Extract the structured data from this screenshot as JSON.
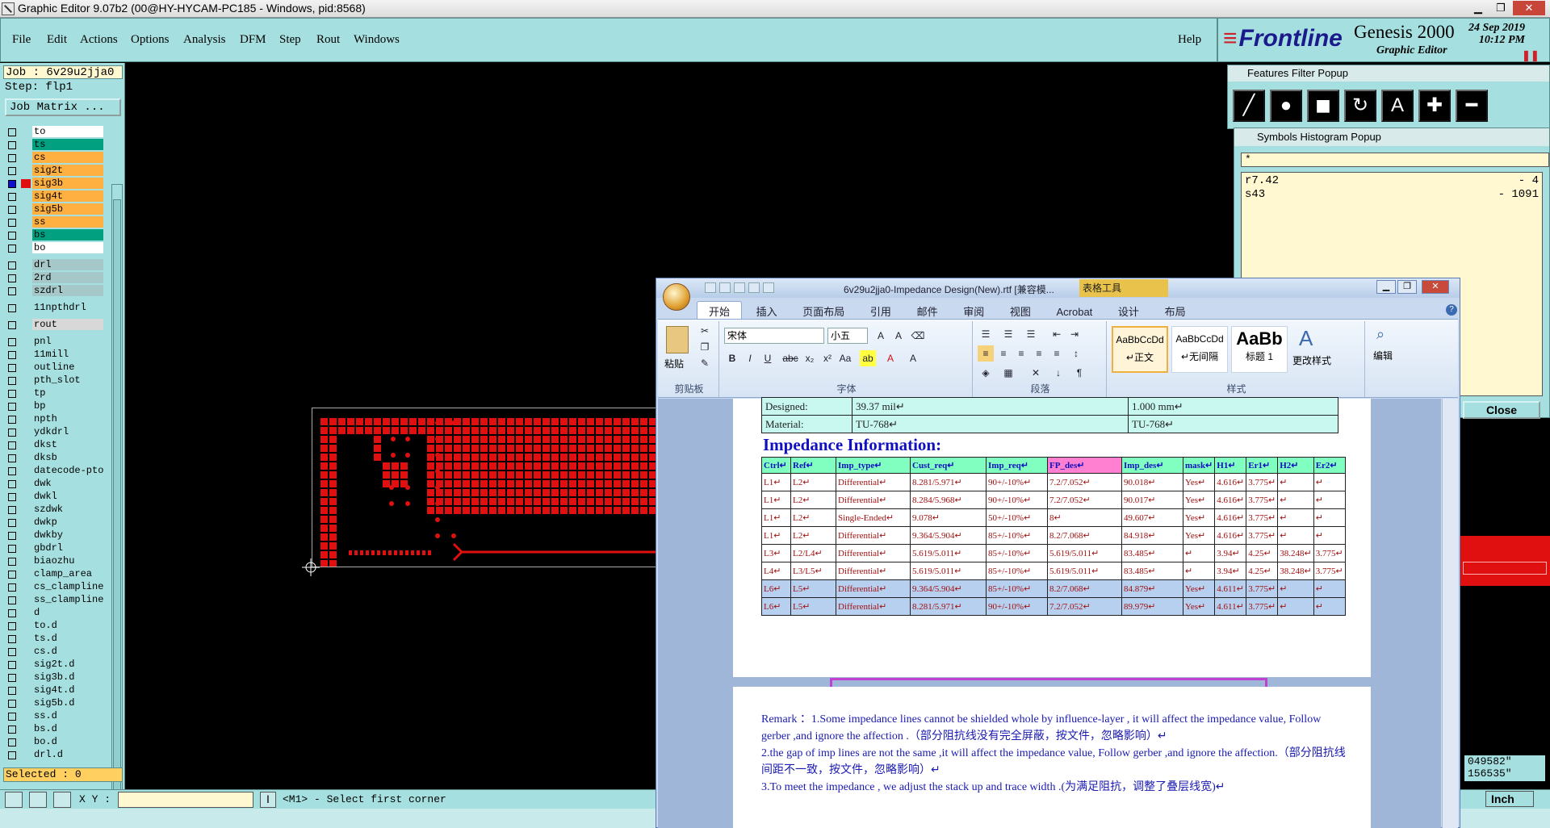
{
  "titlebar": {
    "title": "Graphic Editor 9.07b2 (00@HY-HYCAM-PC185 - Windows, pid:8568)"
  },
  "menu": {
    "items": [
      "File",
      "Edit",
      "Actions",
      "Options",
      "Analysis",
      "DFM",
      "Step",
      "Rout",
      "Windows"
    ],
    "help": "Help"
  },
  "logo": {
    "brand": "Frontline",
    "product": "Genesis 2000",
    "subtitle": "Graphic Editor",
    "date": "24 Sep 2019",
    "time": "10:12 PM"
  },
  "job": {
    "job_label": "Job : 6v29u2jja0",
    "step_label": "Step: flp1",
    "matrix_button": "Job Matrix ..."
  },
  "layers": [
    {
      "name": "to",
      "color": "#ffffff",
      "g": 0
    },
    {
      "name": "ts",
      "color": "#00a080",
      "g": 0
    },
    {
      "name": "cs",
      "color": "#ffb040",
      "g": 0
    },
    {
      "name": "sig2t",
      "color": "#ffb040",
      "g": 0
    },
    {
      "name": "sig3b",
      "color": "#ffb040",
      "g": 0,
      "active": true
    },
    {
      "name": "sig4t",
      "color": "#ffb040",
      "g": 0
    },
    {
      "name": "sig5b",
      "color": "#ffb040",
      "g": 0
    },
    {
      "name": "ss",
      "color": "#ffb040",
      "g": 0
    },
    {
      "name": "bs",
      "color": "#00a080",
      "g": 0
    },
    {
      "name": "bo",
      "color": "#ffffff",
      "g": 0
    },
    {
      "name": "drl",
      "color": "#a6c8c8",
      "g": 1
    },
    {
      "name": "2rd",
      "color": "#a6c8c8",
      "g": 1
    },
    {
      "name": "szdrl",
      "color": "#a6c8c8",
      "g": 1
    },
    {
      "name": "11npthdrl",
      "color": "#a6dfe0",
      "g": 2
    },
    {
      "name": "rout",
      "color": "#d8d8d8",
      "g": 3
    },
    {
      "name": "pnl",
      "color": "#a6dfe0",
      "g": 4
    },
    {
      "name": "11mill",
      "color": "#a6dfe0",
      "g": 4
    },
    {
      "name": "outline",
      "color": "#a6dfe0",
      "g": 4
    },
    {
      "name": "pth_slot",
      "color": "#a6dfe0",
      "g": 4
    },
    {
      "name": "tp",
      "color": "#a6dfe0",
      "g": 4
    },
    {
      "name": "bp",
      "color": "#a6dfe0",
      "g": 4
    },
    {
      "name": "npth",
      "color": "#a6dfe0",
      "g": 4
    },
    {
      "name": "ydkdrl",
      "color": "#a6dfe0",
      "g": 4
    },
    {
      "name": "dkst",
      "color": "#a6dfe0",
      "g": 4
    },
    {
      "name": "dksb",
      "color": "#a6dfe0",
      "g": 4
    },
    {
      "name": "datecode-pto",
      "color": "#a6dfe0",
      "g": 4
    },
    {
      "name": "dwk",
      "color": "#a6dfe0",
      "g": 4
    },
    {
      "name": "dwkl",
      "color": "#a6dfe0",
      "g": 4
    },
    {
      "name": "szdwk",
      "color": "#a6dfe0",
      "g": 4
    },
    {
      "name": "dwkp",
      "color": "#a6dfe0",
      "g": 4
    },
    {
      "name": "dwkby",
      "color": "#a6dfe0",
      "g": 4
    },
    {
      "name": "gbdrl",
      "color": "#a6dfe0",
      "g": 4
    },
    {
      "name": "biaozhu",
      "color": "#a6dfe0",
      "g": 4
    },
    {
      "name": "clamp_area",
      "color": "#a6dfe0",
      "g": 4
    },
    {
      "name": "cs_clampline",
      "color": "#a6dfe0",
      "g": 4
    },
    {
      "name": "ss_clampline",
      "color": "#a6dfe0",
      "g": 4
    },
    {
      "name": "d",
      "color": "#a6dfe0",
      "g": 4
    },
    {
      "name": "to.d",
      "color": "#a6dfe0",
      "g": 4
    },
    {
      "name": "ts.d",
      "color": "#a6dfe0",
      "g": 4
    },
    {
      "name": "cs.d",
      "color": "#a6dfe0",
      "g": 4
    },
    {
      "name": "sig2t.d",
      "color": "#a6dfe0",
      "g": 4
    },
    {
      "name": "sig3b.d",
      "color": "#a6dfe0",
      "g": 4
    },
    {
      "name": "sig4t.d",
      "color": "#a6dfe0",
      "g": 4
    },
    {
      "name": "sig5b.d",
      "color": "#a6dfe0",
      "g": 4
    },
    {
      "name": "ss.d",
      "color": "#a6dfe0",
      "g": 4
    },
    {
      "name": "bs.d",
      "color": "#a6dfe0",
      "g": 4
    },
    {
      "name": "bo.d",
      "color": "#a6dfe0",
      "g": 4
    },
    {
      "name": "drl.d",
      "color": "#a6dfe0",
      "g": 4
    }
  ],
  "status": {
    "selected": "Selected : 0",
    "xy_label": "X Y :",
    "message": "<M1> - Select first corner"
  },
  "features_filter": {
    "title": "Features Filter Popup"
  },
  "symbols_histogram": {
    "title": "Symbols Histogram Popup",
    "filter": "*",
    "rows": [
      {
        "sym": "r7.42",
        "count": "- 4"
      },
      {
        "sym": "s43",
        "count": "- 1091"
      }
    ]
  },
  "close_button": "Close",
  "coords": {
    "x": "049582\"",
    "y": "156535\""
  },
  "units": "Inch",
  "word": {
    "title": "6v29u2jja0-Impedance Design(New).rtf [兼容模...",
    "table_tools": "表格工具",
    "tabs": [
      "开始",
      "插入",
      "页面布局",
      "引用",
      "邮件",
      "审阅",
      "视图",
      "Acrobat",
      "设计",
      "布局"
    ],
    "font_name": "宋体",
    "font_size": "小五",
    "paste": "粘贴",
    "groups": {
      "clipboard": "剪贴板",
      "font": "字体",
      "paragraph": "段落",
      "styles": "样式"
    },
    "styles": [
      {
        "sample": "AaBbCcDd",
        "name": "↵正文"
      },
      {
        "sample": "AaBbCcDd",
        "name": "↵无间隔"
      },
      {
        "sample": "AaBb",
        "name": "标题 1"
      }
    ],
    "change_styles": "更改样式",
    "edit": "编辑",
    "material_row": {
      "label": "Material:",
      "v1": "TU-768↵",
      "v2": "TU-768↵"
    },
    "designed_row": {
      "label": "Designed:",
      "v1": "39.37 mil↵",
      "v2": "1.000 mm↵"
    },
    "impedance_title": "Impedance Information:",
    "headers": [
      "Ctrl↵",
      "Ref↵",
      "Imp_type↵",
      "Cust_req↵",
      "Imp_req↵",
      "FP_des↵",
      "Imp_des↵",
      "mask↵",
      "H1↵",
      "Er1↵",
      "H2↵",
      "Er2↵"
    ],
    "rows": [
      [
        "L1↵",
        "L2↵",
        "Differential↵",
        "8.281/5.971↵",
        "90+/-10%↵",
        "7.2/7.052↵",
        "90.018↵",
        "Yes↵",
        "4.616↵",
        "3.775↵",
        "↵",
        "↵"
      ],
      [
        "L1↵",
        "L2↵",
        "Differential↵",
        "8.284/5.968↵",
        "90+/-10%↵",
        "7.2/7.052↵",
        "90.017↵",
        "Yes↵",
        "4.616↵",
        "3.775↵",
        "↵",
        "↵"
      ],
      [
        "L1↵",
        "L2↵",
        "Single-Ended↵",
        "9.078↵",
        "50+/-10%↵",
        "8↵",
        "49.607↵",
        "Yes↵",
        "4.616↵",
        "3.775↵",
        "↵",
        "↵"
      ],
      [
        "L1↵",
        "L2↵",
        "Differential↵",
        "9.364/5.904↵",
        "85+/-10%↵",
        "8.2/7.068↵",
        "84.918↵",
        "Yes↵",
        "4.616↵",
        "3.775↵",
        "↵",
        "↵"
      ],
      [
        "L3↵",
        "L2/L4↵",
        "Differential↵",
        "5.619/5.011↵",
        "85+/-10%↵",
        "5.619/5.011↵",
        "83.485↵",
        "↵",
        "3.94↵",
        "4.25↵",
        "38.248↵",
        "3.775↵"
      ],
      [
        "L4↵",
        "L3/L5↵",
        "Differential↵",
        "5.619/5.011↵",
        "85+/-10%↵",
        "5.619/5.011↵",
        "83.485↵",
        "↵",
        "3.94↵",
        "4.25↵",
        "38.248↵",
        "3.775↵"
      ],
      [
        "L6↵",
        "L5↵",
        "Differential↵",
        "9.364/5.904↵",
        "85+/-10%↵",
        "8.2/7.068↵",
        "84.879↵",
        "Yes↵",
        "4.611↵",
        "3.775↵",
        "↵",
        "↵"
      ],
      [
        "L6↵",
        "L5↵",
        "Differential↵",
        "8.281/5.971↵",
        "90+/-10%↵",
        "7.2/7.052↵",
        "89.979↵",
        "Yes↵",
        "4.611↵",
        "3.775↵",
        "↵",
        "↵"
      ]
    ],
    "remarks": [
      "Remark ：1.Some impedance lines cannot be shielded whole by influence-layer , it will affect the impedance value, Follow gerber ,and ignore the affection .（部分阻抗线没有完全屏蔽，按文件，忽略影响）↵",
      "2.the gap of imp lines are not the same ,it will affect the impedance value, Follow gerber ,and ignore the affection.（部分阻抗线间距不一致，按文件，忽略影响）↵",
      "3.To meet the impedance , we adjust the stack up and trace width .(为满足阻抗，调整了叠层线宽)↵"
    ]
  }
}
